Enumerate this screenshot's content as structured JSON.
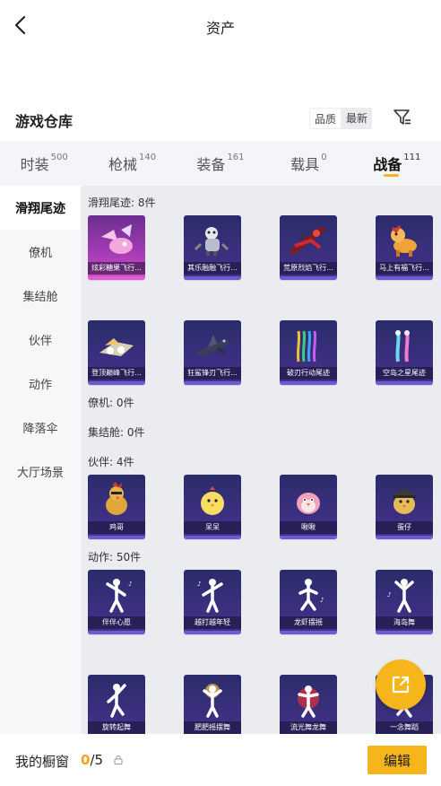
{
  "header": {
    "title": "资产"
  },
  "warehouse": {
    "title": "游戏仓库",
    "sort_options": [
      "品质",
      "最新"
    ]
  },
  "tabs": [
    {
      "label": "时装",
      "count": "500"
    },
    {
      "label": "枪械",
      "count": "140"
    },
    {
      "label": "装备",
      "count": "161"
    },
    {
      "label": "载具",
      "count": "0"
    },
    {
      "label": "战备",
      "count": "111",
      "active": true
    }
  ],
  "sidebar": [
    "滑翔尾迹",
    "僚机",
    "集结舱",
    "伙伴",
    "动作",
    "降落伞",
    "大厅场景"
  ],
  "sections": {
    "glide": "滑翔尾迹: 8件",
    "wingman": "僚机: 0件",
    "capsule": "集结舱: 0件",
    "partner": "伙伴: 4件",
    "action": "动作: 50件"
  },
  "items": {
    "glide": [
      "炫彩糖果飞行...",
      "其乐融融飞行...",
      "荒原烈焰飞行...",
      "马上有福飞行...",
      "登顶巅峰飞行...",
      "狂鲨锋刃飞行...",
      "破刃行动尾迹",
      "空岛之星尾迹"
    ],
    "partner": [
      "鸡哥",
      "呆呆",
      "啾啾",
      "蛋仔"
    ],
    "action": [
      "伴伴心愿",
      "越打越年轻",
      "龙虾摆摇",
      "海岛舞",
      "旋转起舞",
      "肥肥摇摆舞",
      "流光舞龙舞",
      "一念舞蹈"
    ]
  },
  "bottom": {
    "label": "我的橱窗",
    "current": "0",
    "total": "/5",
    "edit": "编辑"
  },
  "colors": {
    "accent": "#f7b51c",
    "card_bg": "#2e2c72",
    "card_purple": "#a83cb7"
  },
  "icons": [
    "back-arrow-icon",
    "filter-icon",
    "share-icon",
    "lock-icon"
  ]
}
